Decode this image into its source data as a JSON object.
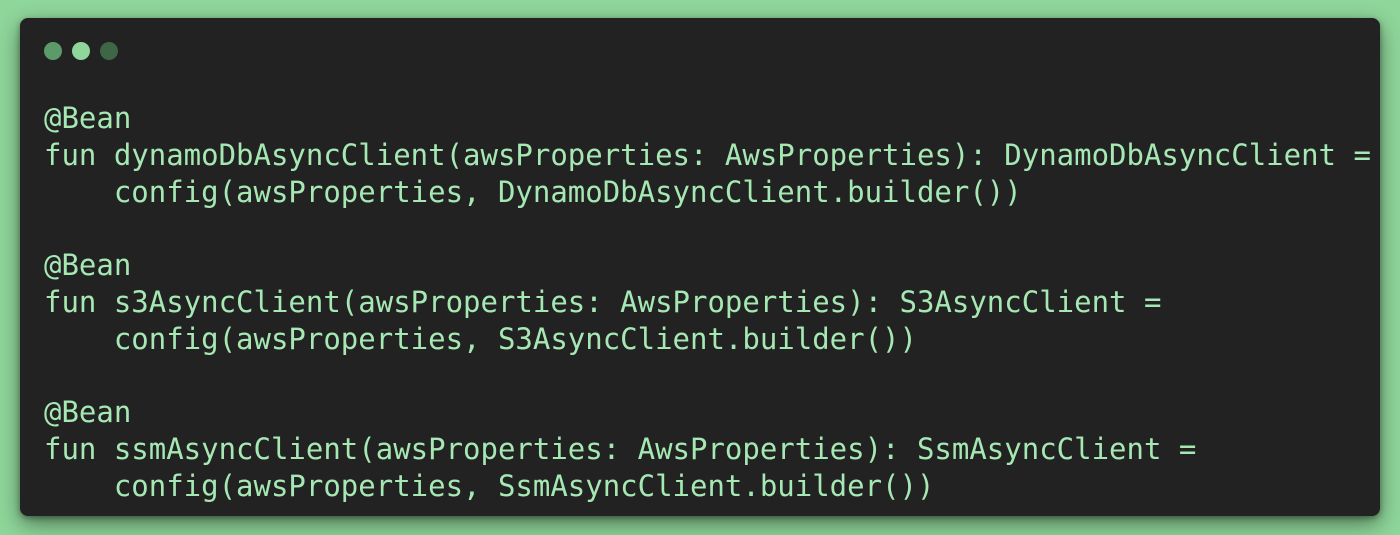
{
  "window": {
    "controls": [
      {
        "name": "close-dot",
        "color": "#5d9a6a"
      },
      {
        "name": "minimize-dot",
        "color": "#8fd69a"
      },
      {
        "name": "maximize-dot",
        "color": "#3e6647"
      }
    ]
  },
  "code": {
    "lines": [
      "@Bean",
      "fun dynamoDbAsyncClient(awsProperties: AwsProperties): DynamoDbAsyncClient =",
      "    config(awsProperties, DynamoDbAsyncClient.builder())",
      "",
      "@Bean",
      "fun s3AsyncClient(awsProperties: AwsProperties): S3AsyncClient =",
      "    config(awsProperties, S3AsyncClient.builder())",
      "",
      "@Bean",
      "fun ssmAsyncClient(awsProperties: AwsProperties): SsmAsyncClient =",
      "    config(awsProperties, SsmAsyncClient.builder())"
    ]
  }
}
